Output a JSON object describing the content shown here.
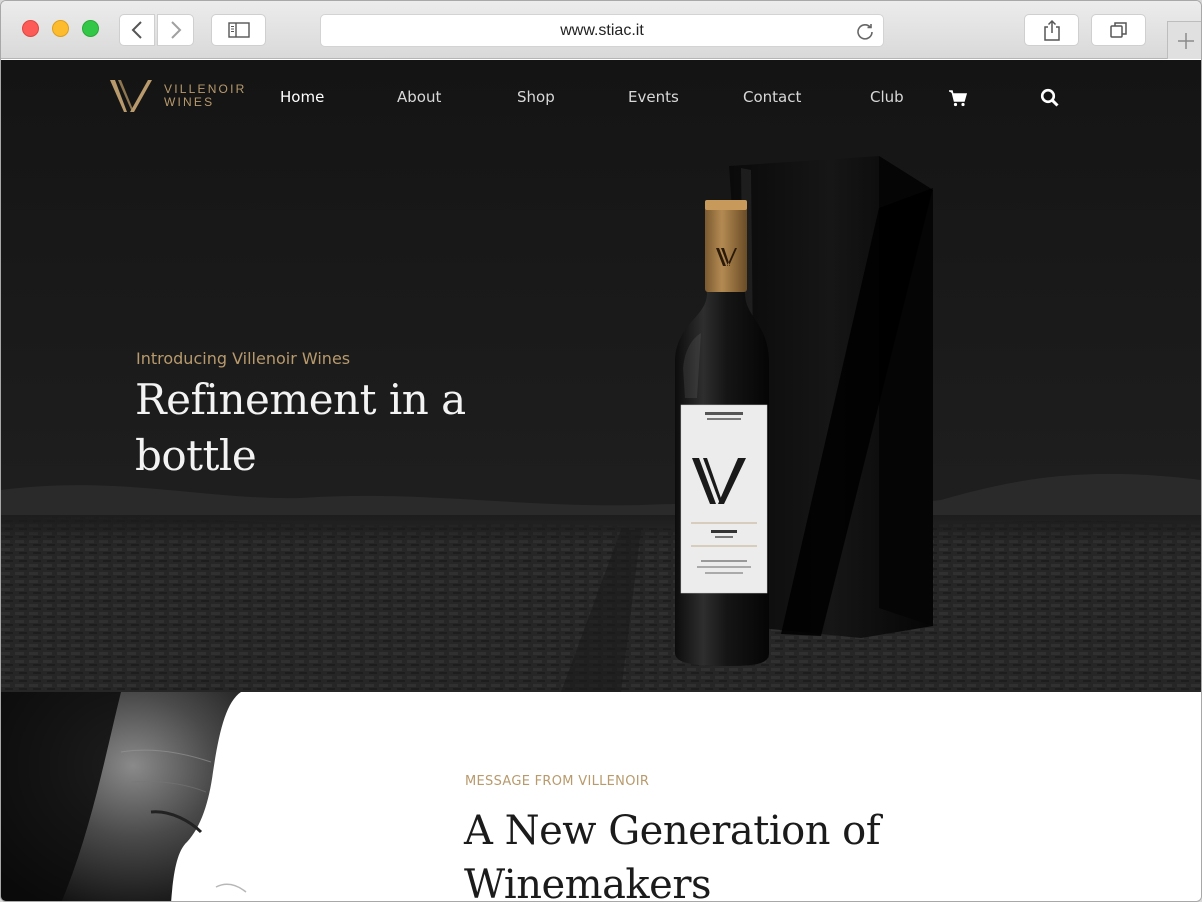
{
  "browser": {
    "url": "www.stiac.it"
  },
  "site": {
    "logo": {
      "line1": "VILLENOIR",
      "line2": "WINES"
    },
    "nav": {
      "items": [
        "Home",
        "About",
        "Shop",
        "Events",
        "Contact",
        "Club"
      ],
      "active": "Home",
      "icons": [
        "cart-icon",
        "search-icon"
      ]
    }
  },
  "hero": {
    "eyebrow": "Introducing Villenoir Wines",
    "title": "Refinement in a bottle"
  },
  "message": {
    "eyebrow": "MESSAGE FROM VILLENOIR",
    "title": "A New Generation of Winemakers"
  },
  "colors": {
    "accent": "#b89a6c",
    "hero_bg": "#1a1a1a",
    "text_dark": "#1b1b1b"
  }
}
